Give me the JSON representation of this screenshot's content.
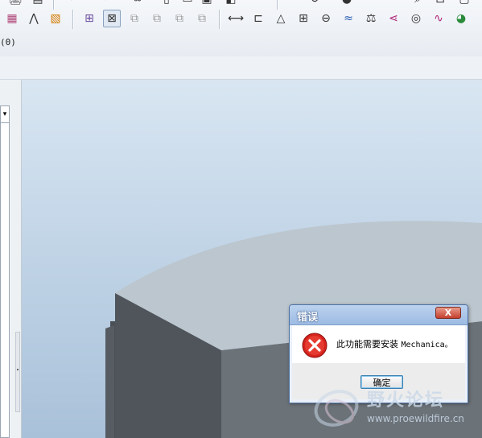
{
  "status_line": "(0)",
  "toolbar": {
    "row1_icons": [
      "print-icon",
      "save-icon",
      "undo-icon",
      "redo-icon",
      "link-icon",
      "new-icon",
      "copy-icon",
      "paste-icon",
      "mirror-icon",
      "layer-icon",
      "select-icon",
      "regen-icon",
      "spin-icon",
      "sphere-icon",
      "search-icon",
      "zoom-icon",
      "settings-icon"
    ],
    "row2_icons": [
      "texture-icon",
      "wedge-icon",
      "color-swatch-icon",
      "model-tree-icon",
      "wireframe-icon",
      "hidden-line-icon",
      "no-hidden-icon",
      "shading-icon",
      "enhanced-shading-icon",
      "dimension-icon",
      "surface-finish-icon",
      "datum-icon",
      "table-icon",
      "geom-tolerance-icon",
      "curvature-icon",
      "weight-icon",
      "analysis-icon",
      "draft-icon",
      "deviation-icon",
      "shade-color-icon"
    ]
  },
  "dialog": {
    "title": "错误",
    "close_label": "X",
    "message_cn": "此功能需要安装 ",
    "message_mono": "Mechanica。",
    "ok_label": "确定"
  },
  "watermark": {
    "text": "野火论坛",
    "url": "www.proewildfire.cn"
  },
  "colors": {
    "accent": "#4e71a3",
    "error_red": "#d6221c",
    "viewport_top": "#d9e6f2",
    "model_top": "#bcc6ce",
    "model_side": "#4f555b"
  }
}
